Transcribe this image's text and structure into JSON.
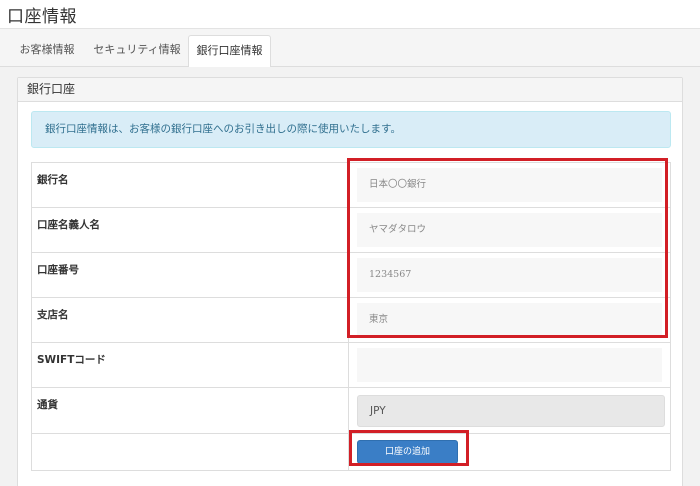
{
  "page": {
    "title": "口座情報"
  },
  "tabs": [
    {
      "label": "お客様情報",
      "active": false
    },
    {
      "label": "セキュリティ情報",
      "active": false
    },
    {
      "label": "銀行口座情報",
      "active": true
    }
  ],
  "panel": {
    "heading": "銀行口座",
    "info_message": "銀行口座情報は、お客様の銀行口座へのお引き出しの際に使用いたします。"
  },
  "form": {
    "rows": [
      {
        "label": "銀行名",
        "value": "日本〇〇銀行"
      },
      {
        "label": "口座名義人名",
        "value": "ヤマダタロウ"
      },
      {
        "label": "口座番号",
        "value": "1234567"
      },
      {
        "label": "支店名",
        "value": "東京"
      },
      {
        "label": "SWIFTコード",
        "value": ""
      },
      {
        "label": "通貨",
        "value": "JPY"
      }
    ],
    "submit_label": "口座の追加"
  },
  "colors": {
    "primary_button": "#3a7ec6",
    "highlight": "#d21f26",
    "info_bg": "#d9edf7"
  }
}
